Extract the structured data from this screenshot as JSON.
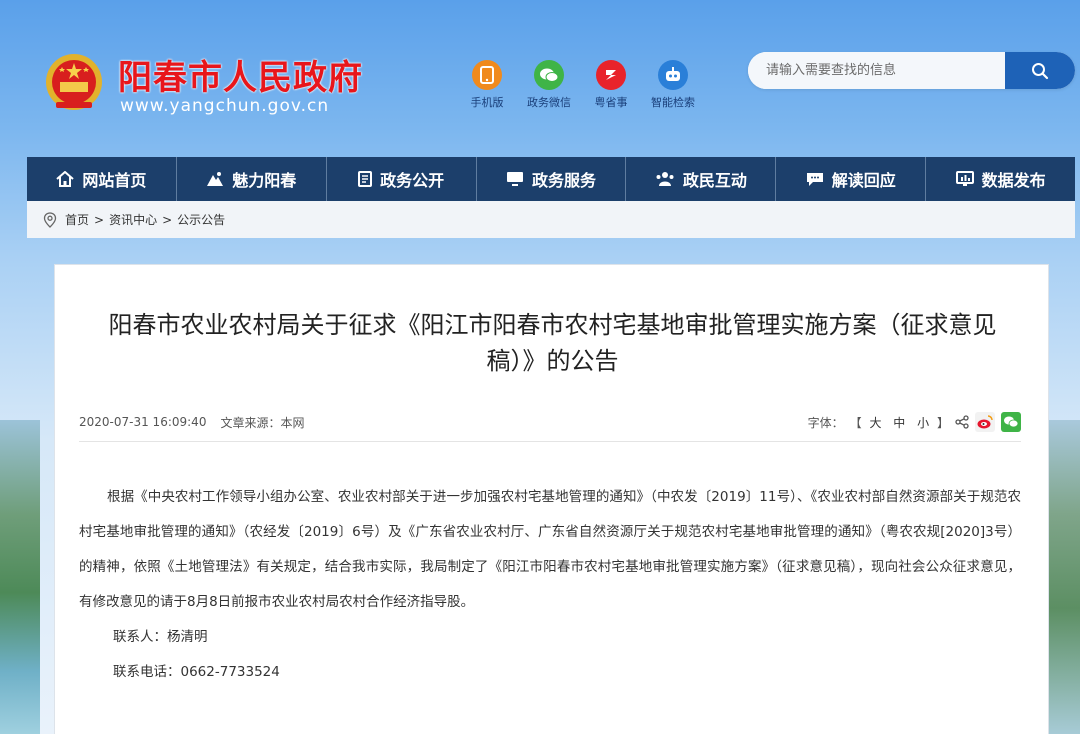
{
  "header": {
    "site_title": "阳春市人民政府",
    "site_url": "www.yangchun.gov.cn",
    "quick_links": [
      {
        "label": "手机版",
        "icon": "mobile-icon",
        "color": "#f08a1d"
      },
      {
        "label": "政务微信",
        "icon": "wechat-icon",
        "color": "#3fb447"
      },
      {
        "label": "粤省事",
        "icon": "yueshengshi-icon",
        "color": "#e8232b"
      },
      {
        "label": "智能检索",
        "icon": "robot-icon",
        "color": "#2a7fd8"
      }
    ],
    "search_placeholder": "请输入需要查找的信息"
  },
  "nav": [
    {
      "label": "网站首页",
      "icon": "home-icon"
    },
    {
      "label": "魅力阳春",
      "icon": "landscape-icon"
    },
    {
      "label": "政务公开",
      "icon": "document-icon"
    },
    {
      "label": "政务服务",
      "icon": "monitor-icon"
    },
    {
      "label": "政民互动",
      "icon": "people-icon"
    },
    {
      "label": "解读回应",
      "icon": "chat-icon"
    },
    {
      "label": "数据发布",
      "icon": "chart-icon"
    }
  ],
  "breadcrumb": [
    "首页",
    "资讯中心",
    "公示公告"
  ],
  "breadcrumb_sep": ">",
  "article": {
    "title": "阳春市农业农村局关于征求《阳江市阳春市农村宅基地审批管理实施方案（征求意见稿）》的公告",
    "date": "2020-07-31 16:09:40",
    "source_label": "文章来源：",
    "source": "本网",
    "font_label": "字体：",
    "font_bracket_open": "【",
    "font_sizes": [
      "大",
      "中",
      "小"
    ],
    "font_bracket_close": "】",
    "body": "根据《中央农村工作领导小组办公室、农业农村部关于进一步加强农村宅基地管理的通知》（中农发〔2019〕11号）、《农业农村部自然资源部关于规范农村宅基地审批管理的通知》（农经发〔2019〕6号）及《广东省农业农村厅、广东省自然资源厅关于规范农村宅基地审批管理的通知》（粤农农规[2020]3号）的精神，依照《土地管理法》有关规定，结合我市实际，我局制定了《阳江市阳春市农村宅基地审批管理实施方案》（征求意见稿），现向社会公众征求意见，有修改意见的请于8月8日前报市农业农村局农村合作经济指导股。",
    "contact_person": "联系人：杨清明",
    "contact_phone": "联系电话：0662-7733524"
  },
  "colors": {
    "nav_bg": "#1c3f6b",
    "title_red": "#e8161b",
    "search_button": "#1e62b7"
  }
}
